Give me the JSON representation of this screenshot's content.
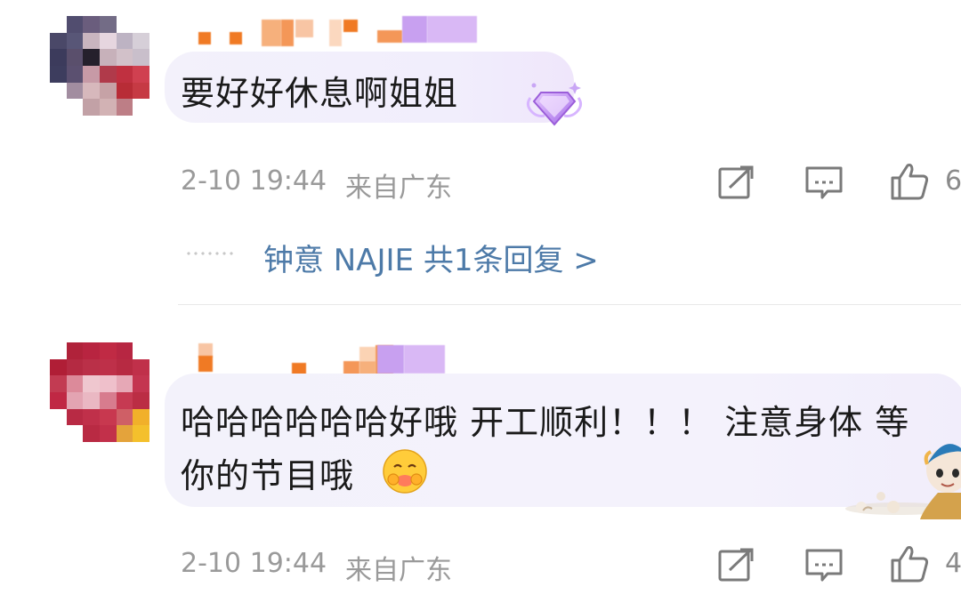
{
  "comments": [
    {
      "text": "要好好休息啊姐姐",
      "time": "2-10 19:44",
      "location": "来自广东",
      "like_count": "6"
    },
    {
      "text_line1": "哈哈哈哈哈哈好哦 开工顺利！！！ 注意身体 等",
      "text_line2": "你的节目哦",
      "time": "2-10 19:44",
      "location": "来自广东",
      "like_count": "4"
    }
  ],
  "reply_link": "钟意 NAJIE  共1条回复 >",
  "icons": {
    "share": "share-icon",
    "comment": "comment-icon",
    "like": "thumbs-up-icon",
    "badge": "diamond-badge-icon",
    "emoji": "hug-emoji-icon",
    "sticker": "cartoon-sticker"
  },
  "colors": {
    "link": "#4d7aa8",
    "meta": "#9a9a9a",
    "text": "#1a1a1a"
  }
}
